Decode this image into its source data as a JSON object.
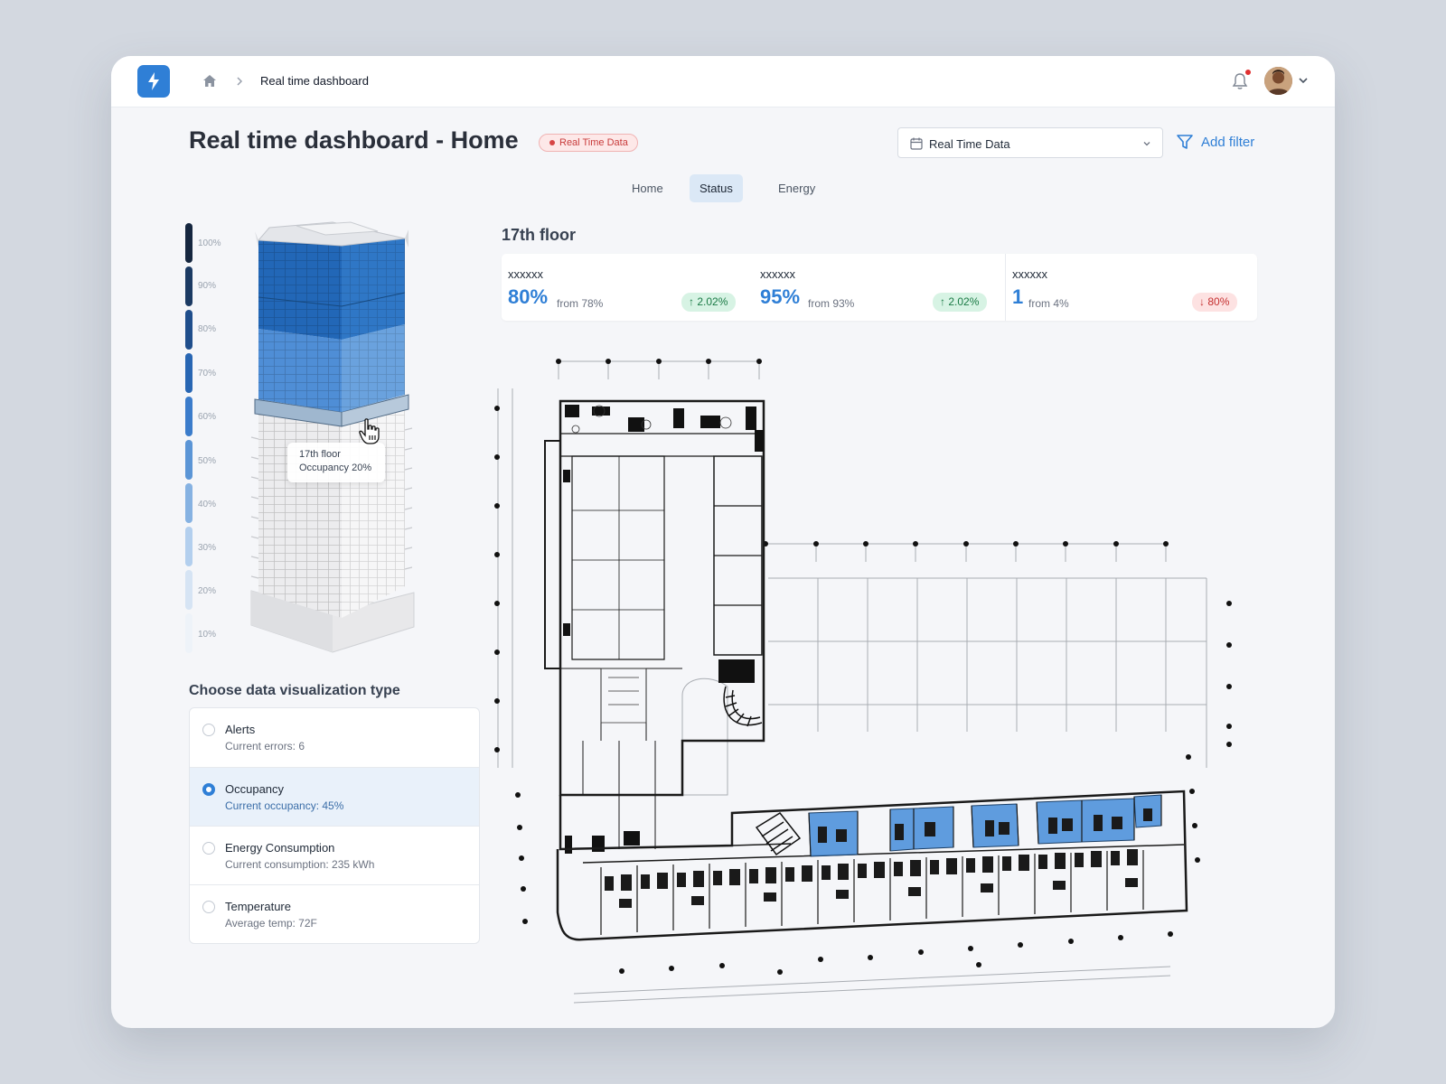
{
  "breadcrumb": {
    "current": "Real time dashboard"
  },
  "header": {
    "title": "Real time dashboard - Home",
    "badge": "Real Time Data",
    "select_value": "Real Time Data",
    "add_filter": "Add filter"
  },
  "tabs": [
    {
      "label": "Home",
      "active": false
    },
    {
      "label": "Status",
      "active": true
    },
    {
      "label": "Energy",
      "active": false
    }
  ],
  "scale": [
    "100%",
    "90%",
    "80%",
    "70%",
    "60%",
    "50%",
    "40%",
    "30%",
    "20%",
    "10%"
  ],
  "tooltip": {
    "line1": "17th floor",
    "line2": "Occupancy 20%"
  },
  "viz": {
    "title": "Choose data visualization type",
    "items": [
      {
        "name": "Alerts",
        "sub": "Current errors: 6",
        "selected": false
      },
      {
        "name": "Occupancy",
        "sub": "Current occupancy: 45%",
        "selected": true
      },
      {
        "name": "Energy Consumption",
        "sub": "Current consumption: 235 kWh",
        "selected": false
      },
      {
        "name": "Temperature",
        "sub": "Average temp: 72F",
        "selected": false
      }
    ]
  },
  "floor": {
    "title": "17th floor",
    "stats": [
      {
        "label": "xxxxxx",
        "value": "80%",
        "from": "from 78%",
        "change": "2.02%",
        "direction": "up"
      },
      {
        "label": "xxxxxx",
        "value": "95%",
        "from": "from 93%",
        "change": "2.02%",
        "direction": "up"
      },
      {
        "label": "xxxxxx",
        "value": "1",
        "from": "from 4%",
        "change": "80%",
        "direction": "down"
      }
    ]
  },
  "colors": {
    "accent": "#2f7fd6",
    "highlight_room": "#4a90d9",
    "badge_red": "#c83b3b"
  },
  "icons": [
    "bolt-icon",
    "home-icon",
    "chevron-right-icon",
    "bell-icon",
    "chevron-down-icon",
    "calendar-icon",
    "filter-icon",
    "arrow-up-icon",
    "arrow-down-icon",
    "hand-cursor-icon"
  ]
}
